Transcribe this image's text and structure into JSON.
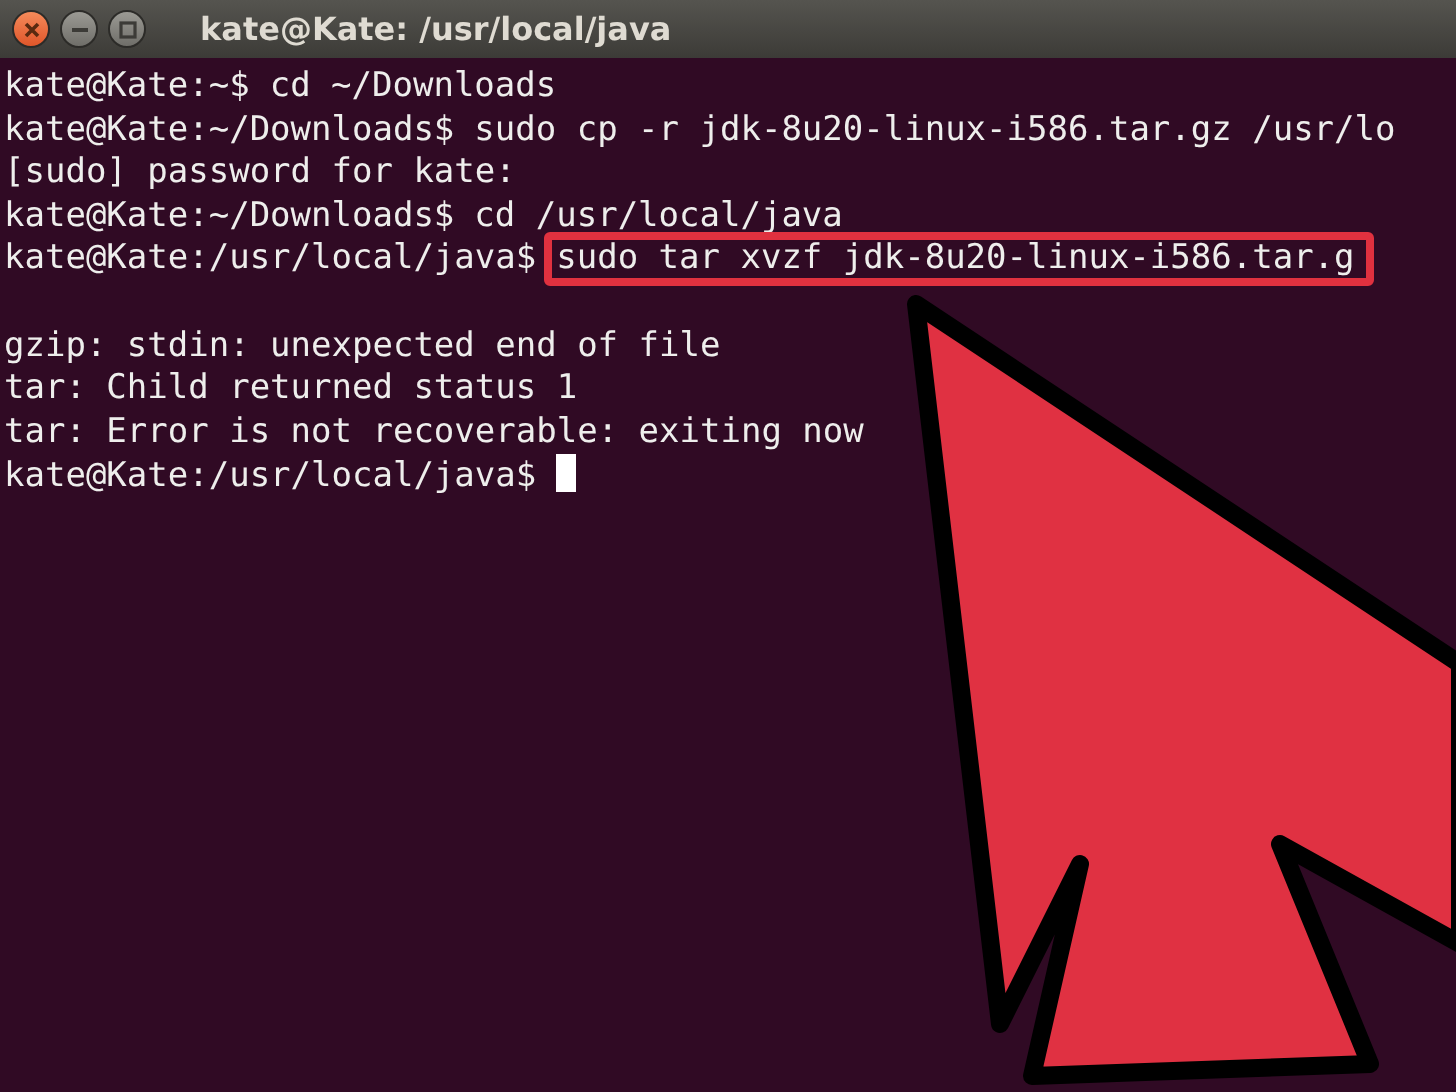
{
  "window": {
    "title": "kate@Kate: /usr/local/java"
  },
  "terminal": {
    "lines": [
      {
        "kind": "command",
        "prompt": "kate@Kate:~$",
        "command": "cd ~/Downloads"
      },
      {
        "kind": "command",
        "prompt": "kate@Kate:~/Downloads$",
        "command": "sudo cp -r jdk-8u20-linux-i586.tar.gz /usr/lo"
      },
      {
        "kind": "output",
        "text": "[sudo] password for kate:"
      },
      {
        "kind": "command",
        "prompt": "kate@Kate:~/Downloads$",
        "command": "cd /usr/local/java"
      },
      {
        "kind": "highlighted_command",
        "prompt": "kate@Kate:/usr/local/java$",
        "command": "sudo tar xvzf jdk-8u20-linux-i586.tar.g"
      },
      {
        "kind": "blank"
      },
      {
        "kind": "output",
        "text": "gzip: stdin: unexpected end of file"
      },
      {
        "kind": "output",
        "text": "tar: Child returned status 1"
      },
      {
        "kind": "output",
        "text": "tar: Error is not recoverable: exiting now"
      },
      {
        "kind": "input",
        "prompt": "kate@Kate:/usr/local/java$"
      }
    ]
  }
}
